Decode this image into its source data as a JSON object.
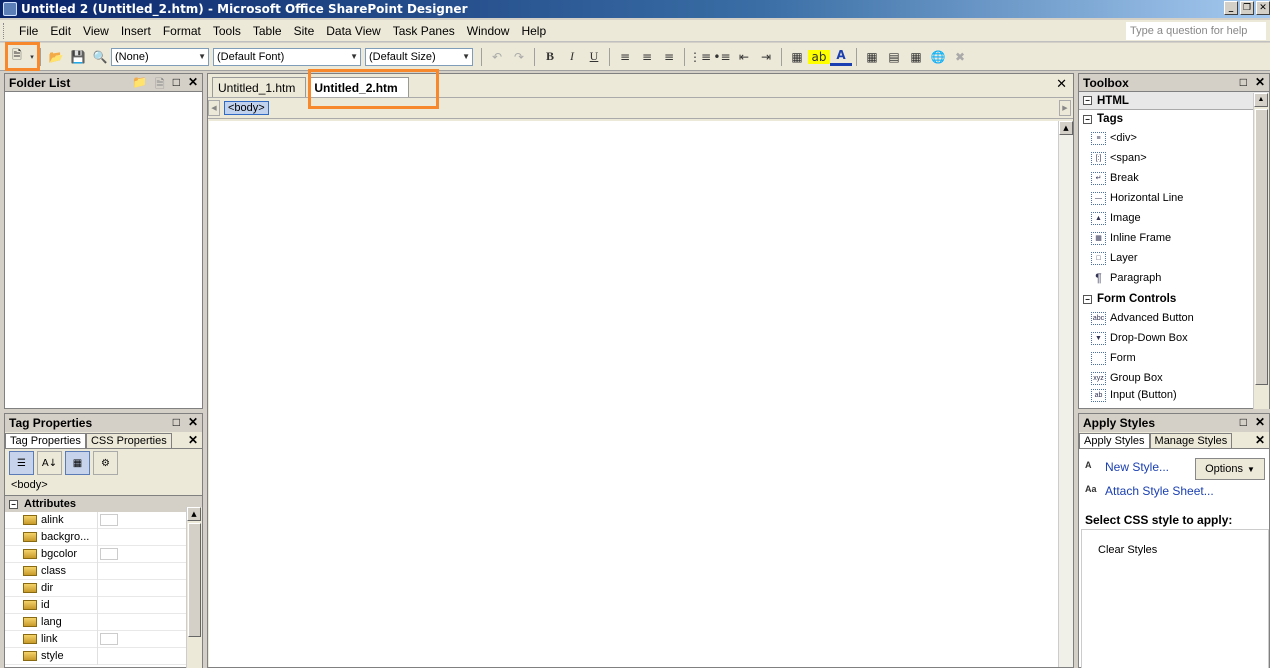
{
  "window": {
    "title": "Untitled 2 (Untitled_2.htm) - Microsoft Office SharePoint Designer",
    "controls": [
      "_",
      "❐",
      "✕"
    ]
  },
  "menu": [
    "File",
    "Edit",
    "View",
    "Insert",
    "Format",
    "Tools",
    "Table",
    "Site",
    "Data View",
    "Task Panes",
    "Window",
    "Help"
  ],
  "ask_placeholder": "Type a question for help",
  "toolbar": {
    "style_combo": "(None)",
    "font_combo": "(Default Font)",
    "size_combo": "(Default Size)",
    "bold": "B",
    "italic": "I",
    "underline": "U",
    "font_color_letter": "A"
  },
  "folder_list": {
    "title": "Folder List"
  },
  "tag_properties": {
    "title": "Tag Properties",
    "tabs": [
      "Tag Properties",
      "CSS Properties"
    ],
    "selected_tag": "<body>",
    "section": "Attributes",
    "attributes": [
      "alink",
      "backgro...",
      "bgcolor",
      "class",
      "dir",
      "id",
      "lang",
      "link",
      "style"
    ]
  },
  "editor": {
    "tabs": [
      "Untitled_1.htm",
      "Untitled_2.htm"
    ],
    "active_tab": "Untitled_2.htm",
    "quick_tag": "<body>"
  },
  "toolbox": {
    "title": "Toolbox",
    "html_section": "HTML",
    "tags_section": "Tags",
    "tags": [
      "<div>",
      "<span>",
      "Break",
      "Horizontal Line",
      "Image",
      "Inline Frame",
      "Layer",
      "Paragraph"
    ],
    "form_section": "Form Controls",
    "form_controls": [
      "Advanced Button",
      "Drop-Down Box",
      "Form",
      "Group Box",
      "Input (Button)"
    ]
  },
  "apply_styles": {
    "title": "Apply Styles",
    "tabs": [
      "Apply Styles",
      "Manage Styles"
    ],
    "new_style": "New Style...",
    "attach": "Attach Style Sheet...",
    "options": "Options",
    "select_label": "Select CSS style to apply:",
    "clear": "Clear Styles"
  },
  "colors": {
    "highlight": "#f7892c",
    "title_bar": "#0a246a",
    "link": "#1a3fb0"
  }
}
